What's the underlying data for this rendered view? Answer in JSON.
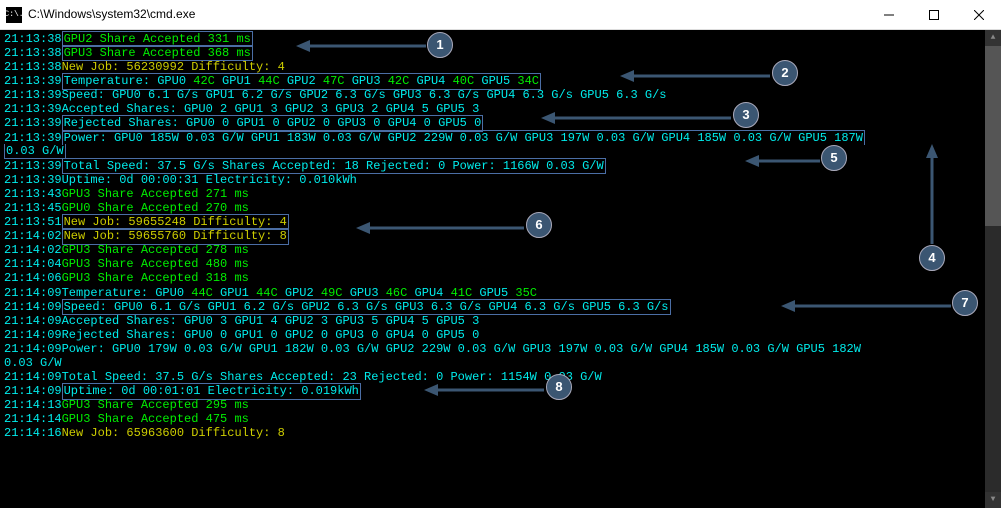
{
  "window": {
    "title": "C:\\Windows\\system32\\cmd.exe",
    "icon_text": "C:\\."
  },
  "callouts": {
    "c1": "1",
    "c2": "2",
    "c3": "3",
    "c4": "4",
    "c5": "5",
    "c6": "6",
    "c7": "7",
    "c8": "8"
  },
  "lines": {
    "l0_time": "21:13:38",
    "l0_text": "GPU2 Share Accepted 331 ms",
    "l1_time": "21:13:38",
    "l1_text": "GPU3 Share Accepted 368 ms",
    "l2_time": "21:13:38",
    "l2_text": "New Job: 56230992 Difficulty: 4",
    "l3_time": "21:13:39",
    "l3_label": "Temperature: ",
    "l3_g0": "GPU0 ",
    "l3_v0": "42C",
    "l3_g1": " GPU1 ",
    "l3_v1": "44C",
    "l3_g2": " GPU2 ",
    "l3_v2": "47C",
    "l3_g3": " GPU3 ",
    "l3_v3": "42C",
    "l3_g4": " GPU4 ",
    "l3_v4": "40C",
    "l3_g5": " GPU5 ",
    "l3_v5": "34C",
    "l4_time": "21:13:39",
    "l4_text": "Speed: GPU0 6.1 G/s GPU1 6.2 G/s GPU2 6.3 G/s GPU3 6.3 G/s GPU4 6.3 G/s GPU5 6.3 G/s",
    "l5_time": "21:13:39",
    "l5_text": "Accepted Shares: GPU0 2 GPU1 3 GPU2 3 GPU3 2 GPU4 5 GPU5 3",
    "l6_time": "21:13:39",
    "l6_text": "Rejected Shares: GPU0 0 GPU1 0 GPU2 0 GPU3 0 GPU4 0 GPU5 0",
    "l7_time": "21:13:39",
    "l7_text": "Power: GPU0 185W 0.03 G/W GPU1 183W 0.03 G/W GPU2 229W 0.03 G/W GPU3 197W 0.03 G/W GPU4 185W 0.03 G/W GPU5 187W",
    "l7b_text": "0.03 G/W",
    "l8_time": "21:13:39",
    "l8_text": "Total Speed: 37.5 G/s Shares Accepted: 18 Rejected: 0 Power: 1166W 0.03 G/W",
    "l9_time": "21:13:39",
    "l9_text": "Uptime: 0d 00:00:31 Electricity: 0.010kWh",
    "l10_time": "21:13:43",
    "l10_text": "GPU3 Share Accepted 271 ms",
    "l11_time": "21:13:45",
    "l11_text": "GPU0 Share Accepted 270 ms",
    "l12_time": "21:13:51",
    "l12_text": "New Job: 59655248 Difficulty: 4",
    "l13_time": "21:14:02",
    "l13_text": "New Job: 59655760 Difficulty: 8",
    "l14_time": "21:14:02",
    "l14_text": "GPU3 Share Accepted 278 ms",
    "l15_time": "21:14:04",
    "l15_text": "GPU3 Share Accepted 480 ms",
    "l16_time": "21:14:06",
    "l16_text": "GPU3 Share Accepted 318 ms",
    "l17_time": "21:14:09",
    "l17_label": "Temperature: ",
    "l17_g0": "GPU0 ",
    "l17_v0": "44C",
    "l17_g1": " GPU1 ",
    "l17_v1": "44C",
    "l17_g2": " GPU2 ",
    "l17_v2": "49C",
    "l17_g3": " GPU3 ",
    "l17_v3": "46C",
    "l17_g4": " GPU4 ",
    "l17_v4": "41C",
    "l17_g5": " GPU5 ",
    "l17_v5": "35C",
    "l18_time": "21:14:09",
    "l18_text": "Speed: GPU0 6.1 G/s GPU1 6.2 G/s GPU2 6.3 G/s GPU3 6.3 G/s GPU4 6.3 G/s GPU5 6.3 G/s",
    "l19_time": "21:14:09",
    "l19_text": "Accepted Shares: GPU0 3 GPU1 4 GPU2 3 GPU3 5 GPU4 5 GPU5 3",
    "l20_time": "21:14:09",
    "l20_text": "Rejected Shares: GPU0 0 GPU1 0 GPU2 0 GPU3 0 GPU4 0 GPU5 0",
    "l21_time": "21:14:09",
    "l21_text": "Power: GPU0 179W 0.03 G/W GPU1 182W 0.03 G/W GPU2 229W 0.03 G/W GPU3 197W 0.03 G/W GPU4 185W 0.03 G/W GPU5 182W",
    "l21b_text": "0.03 G/W",
    "l22_time": "21:14:09",
    "l22_text": "Total Speed: 37.5 G/s Shares Accepted: 23 Rejected: 0 Power: 1154W 0.03 G/W",
    "l23_time": "21:14:09",
    "l23_text": "Uptime: 0d 00:01:01 Electricity: 0.019kWh",
    "l24_time": "21:14:13",
    "l24_text": "GPU3 Share Accepted 295 ms",
    "l25_time": "21:14:14",
    "l25_text": "GPU3 Share Accepted 475 ms",
    "l26_time": "21:14:16",
    "l26_text": "New Job: 65963600 Difficulty: 8"
  }
}
